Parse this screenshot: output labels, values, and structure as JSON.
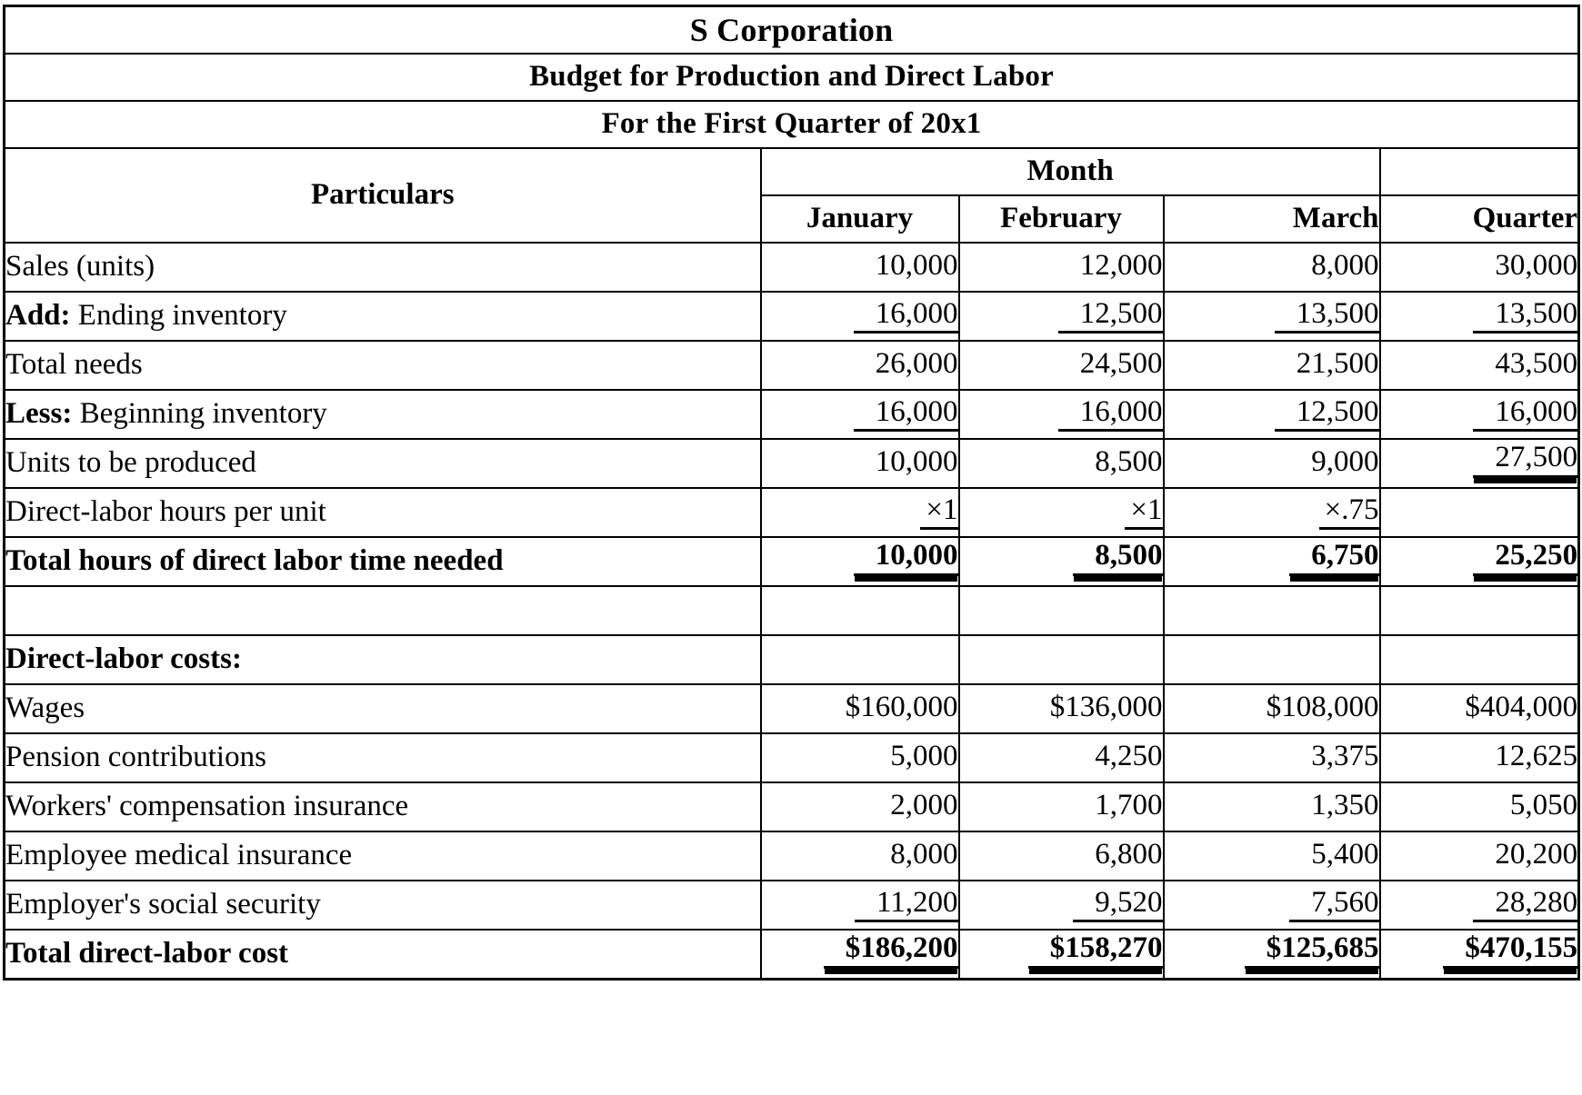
{
  "document": {
    "title_lines": [
      "S Corporation",
      "Budget for Production and Direct Labor",
      "For the First Quarter of 20x1"
    ],
    "header": {
      "particulars": "Particulars",
      "month_group": "Month",
      "columns": [
        "January",
        "February",
        "March",
        "Quarter"
      ]
    }
  },
  "chart_data": {
    "type": "table",
    "title": "S Corporation — Budget for Production and Direct Labor — For the First Quarter of 20x1",
    "columns": [
      "Particulars",
      "January",
      "February",
      "March",
      "Quarter"
    ],
    "rows": [
      {
        "label": "Sales (units)",
        "label_prefix": "",
        "label_bold": false,
        "values": [
          "10,000",
          "12,000",
          "8,000",
          "30,000"
        ],
        "underline": [
          "none",
          "none",
          "none",
          "none"
        ],
        "bold": false
      },
      {
        "label": "Ending inventory",
        "label_prefix": "Add:",
        "label_bold": false,
        "values": [
          "16,000",
          "12,500",
          "13,500",
          "13,500"
        ],
        "underline": [
          "single",
          "single",
          "single",
          "single"
        ],
        "bold": false
      },
      {
        "label": "Total needs",
        "label_prefix": "",
        "label_bold": false,
        "values": [
          "26,000",
          "24,500",
          "21,500",
          "43,500"
        ],
        "underline": [
          "none",
          "none",
          "none",
          "none"
        ],
        "bold": false
      },
      {
        "label": "Beginning inventory",
        "label_prefix": "Less:",
        "label_bold": false,
        "values": [
          "16,000",
          "16,000",
          "12,500",
          "16,000"
        ],
        "underline": [
          "single",
          "single",
          "single",
          "single"
        ],
        "bold": false
      },
      {
        "label": "Units to be produced",
        "label_prefix": "",
        "label_bold": false,
        "values": [
          "10,000",
          "8,500",
          "9,000",
          "27,500"
        ],
        "underline": [
          "none",
          "none",
          "none",
          "double"
        ],
        "bold": false
      },
      {
        "label": "Direct-labor hours per unit",
        "label_prefix": "",
        "label_bold": false,
        "values": [
          "×1",
          "×1",
          "×.75",
          ""
        ],
        "underline": [
          "short",
          "short",
          "short",
          "none"
        ],
        "bold": false
      },
      {
        "label": "Total hours of direct labor time needed",
        "label_prefix": "",
        "label_bold": true,
        "values": [
          "10,000",
          "8,500",
          "6,750",
          "25,250"
        ],
        "underline": [
          "double",
          "double",
          "double",
          "double"
        ],
        "bold": true
      },
      {
        "label": "",
        "label_prefix": "",
        "label_bold": false,
        "values": [
          "",
          "",
          "",
          ""
        ],
        "underline": [
          "none",
          "none",
          "none",
          "none"
        ],
        "bold": false
      },
      {
        "label": "Direct-labor costs:",
        "label_prefix": "",
        "label_bold": true,
        "values": [
          "",
          "",
          "",
          ""
        ],
        "underline": [
          "none",
          "none",
          "none",
          "none"
        ],
        "bold": false
      },
      {
        "label": "Wages",
        "label_prefix": "",
        "label_bold": false,
        "values": [
          "$160,000",
          "$136,000",
          "$108,000",
          "$404,000"
        ],
        "underline": [
          "none",
          "none",
          "none",
          "none"
        ],
        "bold": false
      },
      {
        "label": "Pension contributions",
        "label_prefix": "",
        "label_bold": false,
        "values": [
          "5,000",
          "4,250",
          "3,375",
          "12,625"
        ],
        "underline": [
          "none",
          "none",
          "none",
          "none"
        ],
        "bold": false
      },
      {
        "label": "Workers' compensation insurance",
        "label_prefix": "",
        "label_bold": false,
        "values": [
          "2,000",
          "1,700",
          "1,350",
          "5,050"
        ],
        "underline": [
          "none",
          "none",
          "none",
          "none"
        ],
        "bold": false
      },
      {
        "label": "Employee medical insurance",
        "label_prefix": "",
        "label_bold": false,
        "values": [
          "8,000",
          "6,800",
          "5,400",
          "20,200"
        ],
        "underline": [
          "none",
          "none",
          "none",
          "none"
        ],
        "bold": false
      },
      {
        "label": "Employer's social security",
        "label_prefix": "",
        "label_bold": false,
        "values": [
          "11,200",
          "9,520",
          "7,560",
          "28,280"
        ],
        "underline": [
          "single",
          "single",
          "single",
          "single"
        ],
        "bold": false
      },
      {
        "label": "Total direct-labor cost",
        "label_prefix": "",
        "label_bold": true,
        "values": [
          "$186,200",
          "$158,270",
          "$125,685",
          "$470,155"
        ],
        "underline": [
          "double",
          "double",
          "double",
          "double"
        ],
        "bold": true
      }
    ]
  }
}
